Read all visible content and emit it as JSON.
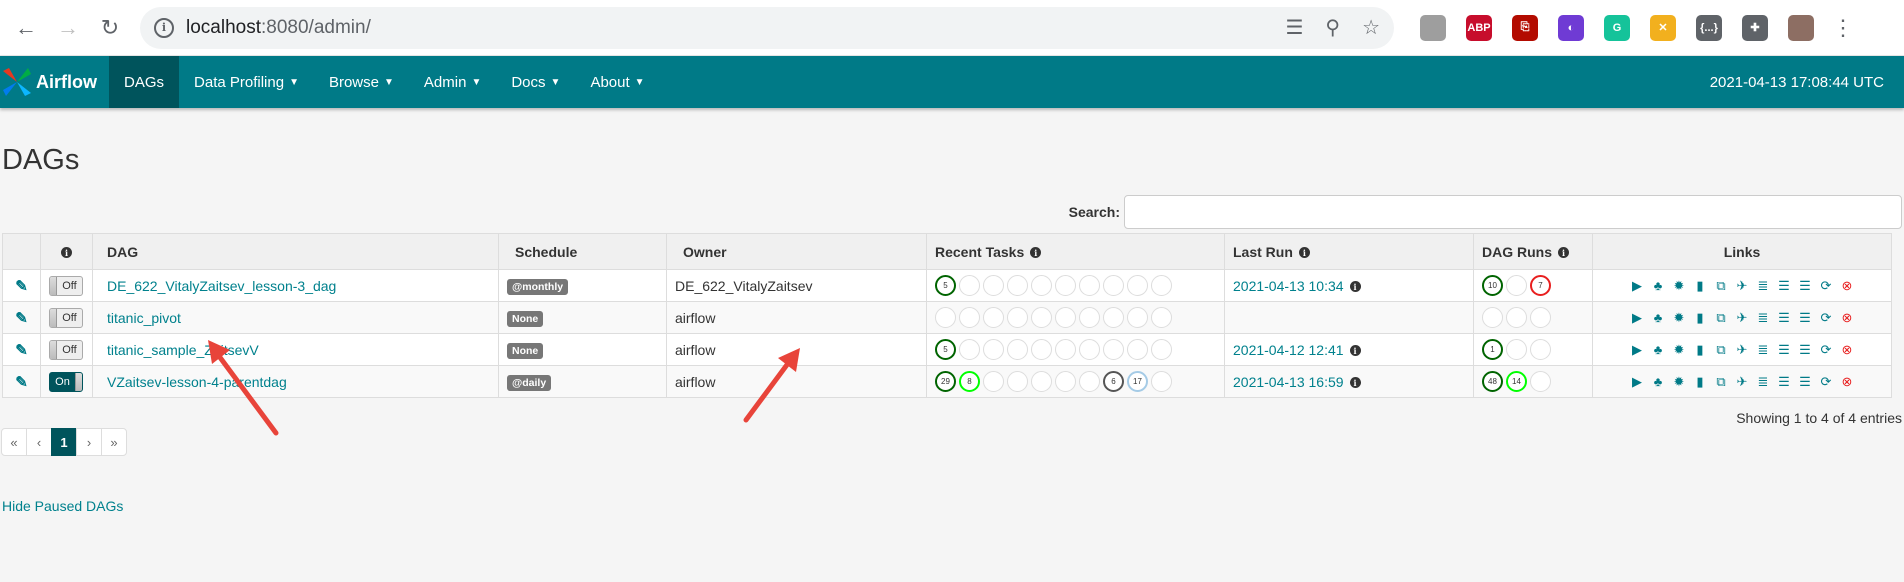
{
  "browser": {
    "url_host": "localhost",
    "url_rest": ":8080/admin/",
    "icons": {
      "back": "arrow-left-icon",
      "forward": "arrow-right-icon",
      "reload": "reload-icon",
      "info": "info-icon",
      "translate": "translate-icon",
      "zoom": "zoom-out-icon",
      "star": "star-icon"
    },
    "extensions": [
      {
        "name": "profile-photo-ext-icon",
        "text": "",
        "color": "#9e9e9e"
      },
      {
        "name": "adblock-plus-icon",
        "text": "ABP",
        "color": "#c70d2c"
      },
      {
        "name": "pdf-icon",
        "text": "⎘",
        "color": "#b30b00"
      },
      {
        "name": "extension-purple-icon",
        "text": "◐",
        "color": "#6f3bd4"
      },
      {
        "name": "grammarly-icon",
        "text": "G",
        "color": "#15c39a"
      },
      {
        "name": "extension-x-icon",
        "text": "✕",
        "color": "#f2b01e"
      },
      {
        "name": "json-viewer-icon",
        "text": "{...}",
        "color": "#5f6368"
      },
      {
        "name": "puzzle-icon",
        "text": "✚",
        "color": "#5f6368"
      },
      {
        "name": "user-avatar-icon",
        "text": "",
        "color": "#8d6e63"
      }
    ]
  },
  "navbar": {
    "brand": "Airflow",
    "items": [
      {
        "label": "DAGs",
        "dropdown": false,
        "active": true
      },
      {
        "label": "Data Profiling",
        "dropdown": true
      },
      {
        "label": "Browse",
        "dropdown": true
      },
      {
        "label": "Admin",
        "dropdown": true
      },
      {
        "label": "Docs",
        "dropdown": true
      },
      {
        "label": "About",
        "dropdown": true
      }
    ],
    "time": "2021-04-13 17:08:44 UTC"
  },
  "page": {
    "title": "DAGs",
    "search_label": "Search:",
    "search_value": "",
    "columns": [
      "",
      "",
      "DAG",
      "Schedule",
      "Owner",
      "Recent Tasks",
      "Last Run",
      "DAG Runs",
      "Links"
    ],
    "rows": [
      {
        "toggle": "Off",
        "dag": "DE_622_VitalyZaitsev_lesson-3_dag",
        "schedule": "@monthly",
        "owner": "DE_622_VitalyZaitsev",
        "recent": [
          [
            "success",
            "5"
          ],
          [
            "",
            ""
          ],
          [
            "",
            ""
          ],
          [
            "",
            ""
          ],
          [
            "",
            ""
          ],
          [
            "",
            ""
          ],
          [
            "",
            ""
          ],
          [
            "",
            ""
          ],
          [
            "",
            ""
          ],
          [
            "",
            ""
          ]
        ],
        "last_run": "2021-04-13 10:34",
        "runs": [
          [
            "success",
            "10"
          ],
          [
            "",
            ""
          ],
          [
            "failed",
            "7"
          ]
        ]
      },
      {
        "toggle": "Off",
        "dag": "titanic_pivot",
        "schedule": "None",
        "owner": "airflow",
        "recent": [
          [
            "",
            ""
          ],
          [
            "",
            ""
          ],
          [
            "",
            ""
          ],
          [
            "",
            ""
          ],
          [
            "",
            ""
          ],
          [
            "",
            ""
          ],
          [
            "",
            ""
          ],
          [
            "",
            ""
          ],
          [
            "",
            ""
          ],
          [
            "",
            ""
          ]
        ],
        "last_run": "",
        "runs": [
          [
            "",
            ""
          ],
          [
            "",
            ""
          ],
          [
            "",
            ""
          ]
        ]
      },
      {
        "toggle": "Off",
        "dag": "titanic_sample_ZaitsevV",
        "schedule": "None",
        "owner": "airflow",
        "recent": [
          [
            "success",
            "5"
          ],
          [
            "",
            ""
          ],
          [
            "",
            ""
          ],
          [
            "",
            ""
          ],
          [
            "",
            ""
          ],
          [
            "",
            ""
          ],
          [
            "",
            ""
          ],
          [
            "",
            ""
          ],
          [
            "",
            ""
          ],
          [
            "",
            ""
          ]
        ],
        "last_run": "2021-04-12 12:41",
        "runs": [
          [
            "success",
            "1"
          ],
          [
            "",
            ""
          ],
          [
            "",
            ""
          ]
        ]
      },
      {
        "toggle": "On",
        "dag": "VZaitsev-lesson-4-parentdag",
        "schedule": "@daily",
        "owner": "airflow",
        "recent": [
          [
            "success",
            "29"
          ],
          [
            "running",
            "8"
          ],
          [
            "",
            ""
          ],
          [
            "",
            ""
          ],
          [
            "",
            ""
          ],
          [
            "",
            ""
          ],
          [
            "",
            ""
          ],
          [
            "skipped",
            "6"
          ],
          [
            "scheduled",
            "17"
          ],
          [
            "",
            ""
          ]
        ],
        "last_run": "2021-04-13 16:59",
        "runs": [
          [
            "success",
            "48"
          ],
          [
            "running",
            "14"
          ],
          [
            "",
            ""
          ]
        ]
      }
    ],
    "link_icons": [
      "trigger-dag-icon",
      "tree-view-icon",
      "graph-view-icon",
      "task-duration-icon",
      "task-tries-icon",
      "landing-times-icon",
      "gantt-icon",
      "code-icon",
      "logs-icon",
      "refresh-icon",
      "delete-icon"
    ],
    "showing": "Showing 1 to 4 of 4 entries",
    "pagination": [
      "«",
      "‹",
      "1",
      "›",
      "»"
    ],
    "active_page": "1",
    "hide_paused": "Hide Paused DAGs"
  }
}
